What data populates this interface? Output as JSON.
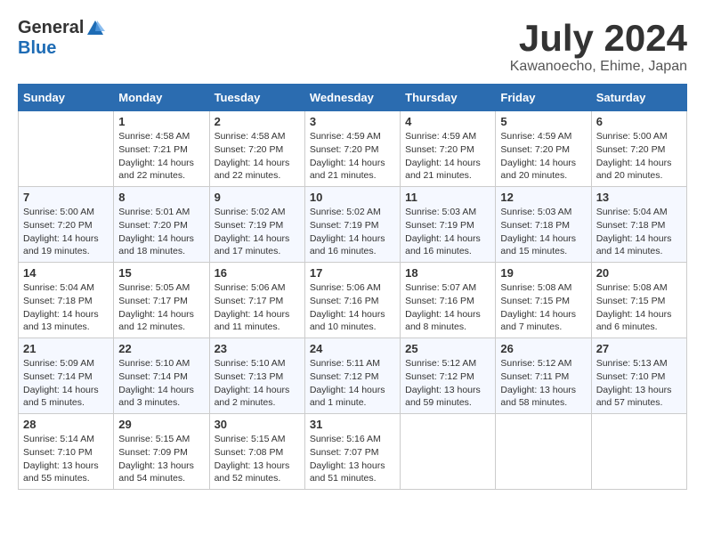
{
  "header": {
    "logo_general": "General",
    "logo_blue": "Blue",
    "month_title": "July 2024",
    "location": "Kawanoecho, Ehime, Japan"
  },
  "columns": [
    "Sunday",
    "Monday",
    "Tuesday",
    "Wednesday",
    "Thursday",
    "Friday",
    "Saturday"
  ],
  "weeks": [
    [
      {
        "day": "",
        "info": ""
      },
      {
        "day": "1",
        "info": "Sunrise: 4:58 AM\nSunset: 7:21 PM\nDaylight: 14 hours\nand 22 minutes."
      },
      {
        "day": "2",
        "info": "Sunrise: 4:58 AM\nSunset: 7:20 PM\nDaylight: 14 hours\nand 22 minutes."
      },
      {
        "day": "3",
        "info": "Sunrise: 4:59 AM\nSunset: 7:20 PM\nDaylight: 14 hours\nand 21 minutes."
      },
      {
        "day": "4",
        "info": "Sunrise: 4:59 AM\nSunset: 7:20 PM\nDaylight: 14 hours\nand 21 minutes."
      },
      {
        "day": "5",
        "info": "Sunrise: 4:59 AM\nSunset: 7:20 PM\nDaylight: 14 hours\nand 20 minutes."
      },
      {
        "day": "6",
        "info": "Sunrise: 5:00 AM\nSunset: 7:20 PM\nDaylight: 14 hours\nand 20 minutes."
      }
    ],
    [
      {
        "day": "7",
        "info": "Sunrise: 5:00 AM\nSunset: 7:20 PM\nDaylight: 14 hours\nand 19 minutes."
      },
      {
        "day": "8",
        "info": "Sunrise: 5:01 AM\nSunset: 7:20 PM\nDaylight: 14 hours\nand 18 minutes."
      },
      {
        "day": "9",
        "info": "Sunrise: 5:02 AM\nSunset: 7:19 PM\nDaylight: 14 hours\nand 17 minutes."
      },
      {
        "day": "10",
        "info": "Sunrise: 5:02 AM\nSunset: 7:19 PM\nDaylight: 14 hours\nand 16 minutes."
      },
      {
        "day": "11",
        "info": "Sunrise: 5:03 AM\nSunset: 7:19 PM\nDaylight: 14 hours\nand 16 minutes."
      },
      {
        "day": "12",
        "info": "Sunrise: 5:03 AM\nSunset: 7:18 PM\nDaylight: 14 hours\nand 15 minutes."
      },
      {
        "day": "13",
        "info": "Sunrise: 5:04 AM\nSunset: 7:18 PM\nDaylight: 14 hours\nand 14 minutes."
      }
    ],
    [
      {
        "day": "14",
        "info": "Sunrise: 5:04 AM\nSunset: 7:18 PM\nDaylight: 14 hours\nand 13 minutes."
      },
      {
        "day": "15",
        "info": "Sunrise: 5:05 AM\nSunset: 7:17 PM\nDaylight: 14 hours\nand 12 minutes."
      },
      {
        "day": "16",
        "info": "Sunrise: 5:06 AM\nSunset: 7:17 PM\nDaylight: 14 hours\nand 11 minutes."
      },
      {
        "day": "17",
        "info": "Sunrise: 5:06 AM\nSunset: 7:16 PM\nDaylight: 14 hours\nand 10 minutes."
      },
      {
        "day": "18",
        "info": "Sunrise: 5:07 AM\nSunset: 7:16 PM\nDaylight: 14 hours\nand 8 minutes."
      },
      {
        "day": "19",
        "info": "Sunrise: 5:08 AM\nSunset: 7:15 PM\nDaylight: 14 hours\nand 7 minutes."
      },
      {
        "day": "20",
        "info": "Sunrise: 5:08 AM\nSunset: 7:15 PM\nDaylight: 14 hours\nand 6 minutes."
      }
    ],
    [
      {
        "day": "21",
        "info": "Sunrise: 5:09 AM\nSunset: 7:14 PM\nDaylight: 14 hours\nand 5 minutes."
      },
      {
        "day": "22",
        "info": "Sunrise: 5:10 AM\nSunset: 7:14 PM\nDaylight: 14 hours\nand 3 minutes."
      },
      {
        "day": "23",
        "info": "Sunrise: 5:10 AM\nSunset: 7:13 PM\nDaylight: 14 hours\nand 2 minutes."
      },
      {
        "day": "24",
        "info": "Sunrise: 5:11 AM\nSunset: 7:12 PM\nDaylight: 14 hours\nand 1 minute."
      },
      {
        "day": "25",
        "info": "Sunrise: 5:12 AM\nSunset: 7:12 PM\nDaylight: 13 hours\nand 59 minutes."
      },
      {
        "day": "26",
        "info": "Sunrise: 5:12 AM\nSunset: 7:11 PM\nDaylight: 13 hours\nand 58 minutes."
      },
      {
        "day": "27",
        "info": "Sunrise: 5:13 AM\nSunset: 7:10 PM\nDaylight: 13 hours\nand 57 minutes."
      }
    ],
    [
      {
        "day": "28",
        "info": "Sunrise: 5:14 AM\nSunset: 7:10 PM\nDaylight: 13 hours\nand 55 minutes."
      },
      {
        "day": "29",
        "info": "Sunrise: 5:15 AM\nSunset: 7:09 PM\nDaylight: 13 hours\nand 54 minutes."
      },
      {
        "day": "30",
        "info": "Sunrise: 5:15 AM\nSunset: 7:08 PM\nDaylight: 13 hours\nand 52 minutes."
      },
      {
        "day": "31",
        "info": "Sunrise: 5:16 AM\nSunset: 7:07 PM\nDaylight: 13 hours\nand 51 minutes."
      },
      {
        "day": "",
        "info": ""
      },
      {
        "day": "",
        "info": ""
      },
      {
        "day": "",
        "info": ""
      }
    ]
  ]
}
